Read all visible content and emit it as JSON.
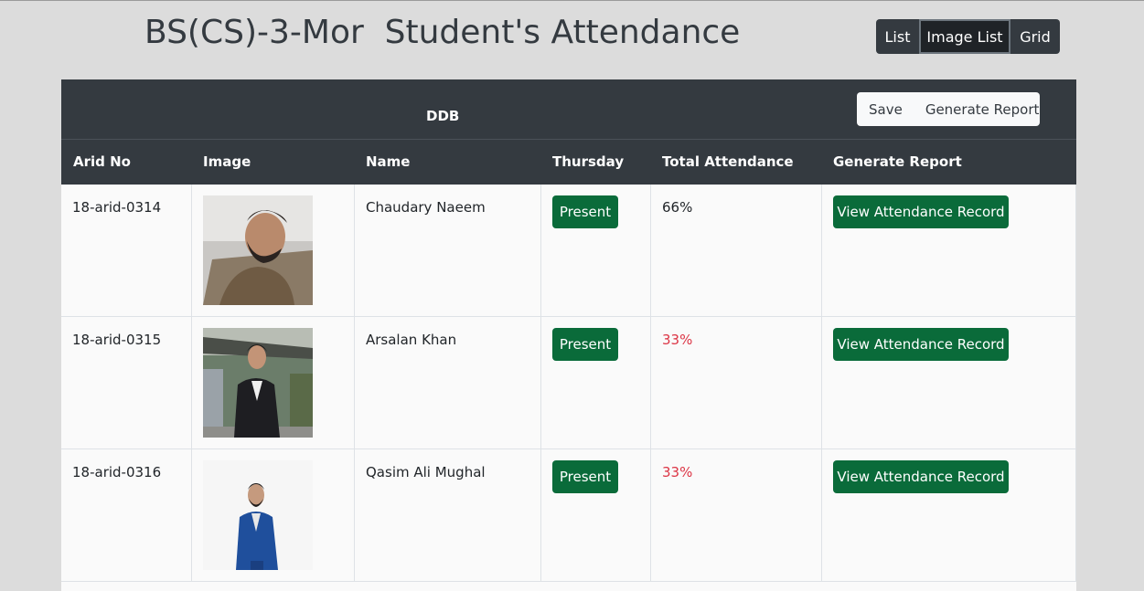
{
  "header": {
    "title": "BS(CS)-3-Mor  Student's Attendance",
    "view_options": [
      "List",
      "Image List",
      "Grid"
    ]
  },
  "card": {
    "class_label": "DDB",
    "actions": {
      "save_label": "Save",
      "report_label": "Generate Report"
    }
  },
  "table": {
    "columns": [
      "Arid No",
      "Image",
      "Name",
      "Thursday",
      "Total Attendance",
      "Generate Report"
    ],
    "rows": [
      {
        "arid_no": "18-arid-0314",
        "name": "Chaudary Naeem",
        "status": "Present",
        "total": "66%",
        "action": "View Attendance Record"
      },
      {
        "arid_no": "18-arid-0315",
        "name": "Arsalan Khan",
        "status": "Present",
        "total": "33%",
        "action": "View Attendance Record"
      },
      {
        "arid_no": "18-arid-0316",
        "name": "Qasim Ali Mughal",
        "status": "Present",
        "total": "33%",
        "action": "View Attendance Record"
      }
    ]
  },
  "colors": {
    "header_dark": "#343a40",
    "present_green": "#0a6b3a",
    "low_attendance_red": "#dc3545"
  }
}
